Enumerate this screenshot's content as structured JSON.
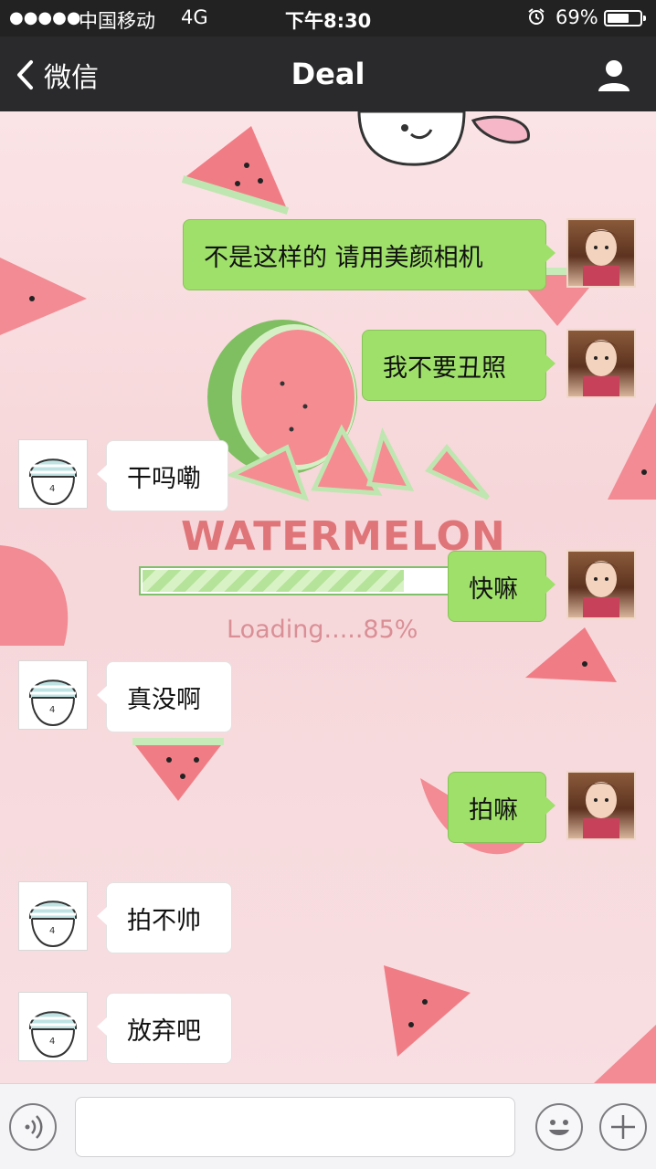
{
  "status_bar": {
    "signal": "●●●●●",
    "carrier": "中国移动",
    "network": "4G",
    "time": "下午8:30",
    "alarm_icon": "alarm-clock-icon",
    "battery_percent": "69%",
    "battery_level": 0.69
  },
  "nav_bar": {
    "back_label": "微信",
    "title": "Deal",
    "back_icon": "chevron-left-icon",
    "profile_icon": "person-icon"
  },
  "background": {
    "title": "watermelon",
    "loading_text": "Loading.....85%",
    "loading_progress": 0.85
  },
  "messages": [
    {
      "direction": "sent",
      "text": "不是这样的 请用美颜相机",
      "avatar": "girl-photo"
    },
    {
      "direction": "sent",
      "text": "我不要丑照",
      "avatar": "girl-photo"
    },
    {
      "direction": "received",
      "text": "干吗嘞",
      "avatar": "sketch-character"
    },
    {
      "direction": "sent",
      "text": "快嘛",
      "avatar": "girl-photo"
    },
    {
      "direction": "received",
      "text": "真没啊",
      "avatar": "sketch-character"
    },
    {
      "direction": "sent",
      "text": "拍嘛",
      "avatar": "girl-photo"
    },
    {
      "direction": "received",
      "text": "拍不帅",
      "avatar": "sketch-character"
    },
    {
      "direction": "received",
      "text": "放弃吧",
      "avatar": "sketch-character"
    }
  ],
  "input_bar": {
    "text_value": "",
    "voice_icon": "voice-icon",
    "emoji_icon": "emoji-icon",
    "plus_icon": "plus-icon"
  },
  "colors": {
    "sent_bubble": "#9fe06a",
    "received_bubble": "#ffffff",
    "nav_background": "#2a2a2c"
  }
}
